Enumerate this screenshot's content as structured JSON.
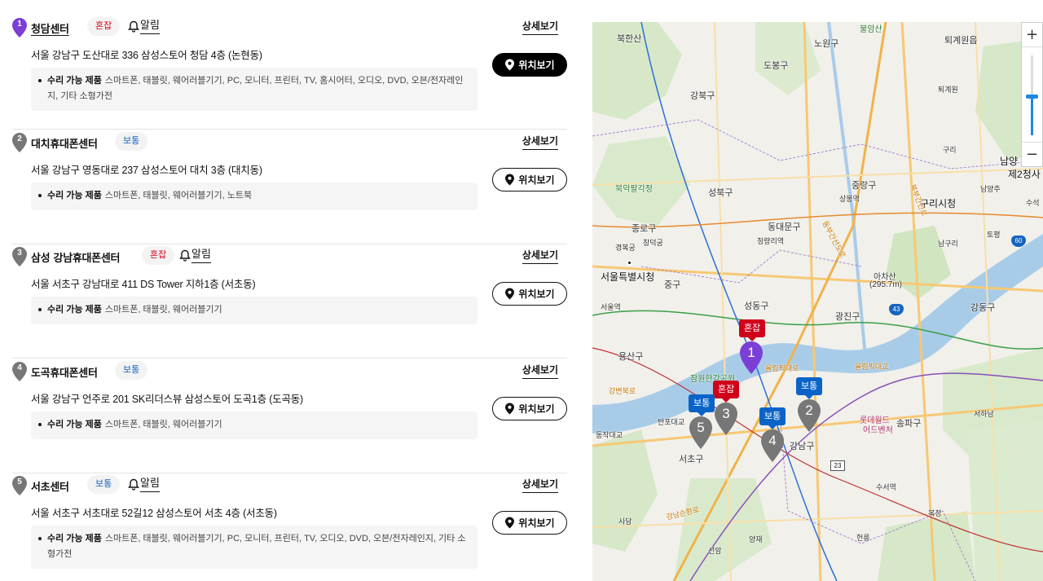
{
  "common": {
    "products_label": "수리 가능 제품",
    "detail_label": "상세보기",
    "location_label": "위치보기",
    "alarm_label": "알림"
  },
  "centers": [
    {
      "num": "1",
      "name": "청담센터",
      "status": "혼잡",
      "status_type": "busy",
      "has_alarm": true,
      "address": "서울 강남구 도산대로 336 삼성스토어 청담 4층 (논현동)",
      "products": "스마트폰, 태블릿, 웨어러블기기, PC, 모니터, 프린터, TV, 홈시어터, 오디오, DVD, 오븐/전자레인지, 기타 소형가전",
      "pin_color": "#7b3fd6",
      "selected": true
    },
    {
      "num": "2",
      "name": "대치휴대폰센터",
      "status": "보통",
      "status_type": "normal",
      "has_alarm": false,
      "address": "서울 강남구 영동대로 237 삼성스토어 대치 3층 (대치동)",
      "products": "스마트폰, 태블릿, 웨어러블기기, 노트북",
      "pin_color": "#777777",
      "selected": false
    },
    {
      "num": "3",
      "name": "삼성 강남휴대폰센터",
      "status": "혼잡",
      "status_type": "busy",
      "has_alarm": true,
      "address": "서울 서초구 강남대로 411 DS Tower 지하1층 (서초동)",
      "products": "스마트폰, 태블릿, 웨어러블기기",
      "pin_color": "#777777",
      "selected": false
    },
    {
      "num": "4",
      "name": "도곡휴대폰센터",
      "status": "보통",
      "status_type": "normal",
      "has_alarm": false,
      "address": "서울 강남구 언주로 201 SK리더스뷰 삼성스토어 도곡1층 (도곡동)",
      "products": "스마트폰, 태블릿, 웨어러블기기",
      "pin_color": "#777777",
      "selected": false
    },
    {
      "num": "5",
      "name": "서초센터",
      "status": "보통",
      "status_type": "normal",
      "has_alarm": true,
      "address": "서울 서초구 서초대로 52길12 삼성스토어 서초 4층 (서초동)",
      "products": "스마트폰, 태블릿, 웨어러블기기, PC, 모니터, 프린터, TV, 오디오, DVD, 오븐/전자레인지, 기타 소형가전",
      "pin_color": "#777777",
      "selected": false
    }
  ],
  "map": {
    "zoom_in": "+",
    "zoom_out": "−",
    "labels": {
      "l01": "북한산",
      "l02": "노원구",
      "l03": "퇴계원읍",
      "l04": "불암산",
      "l05": "강북구",
      "l06": "도봉구",
      "l07": "성북구",
      "l08": "중랑구",
      "l09": "상봉역",
      "l10": "구리시청",
      "l11": "남양",
      "l12": "제2청사",
      "l13": "북악팔각정",
      "l14": "종로구",
      "l15": "동대문구",
      "l16": "청량리역",
      "l17": "경복궁",
      "l18": "창덕궁",
      "l19": "서울특별시청",
      "l20": "중구",
      "l21": "아차산",
      "l22": "(295.7m)",
      "l23": "광진구",
      "l24": "강동구",
      "l25": "성동구",
      "l26": "서울역",
      "l27": "용산구",
      "l28": "잠원한강공원",
      "l29": "강변북로",
      "l30": "올림픽대교",
      "l31": "반포대교",
      "l32": "동작대교",
      "l33": "서초구",
      "l34": "강남구",
      "l35": "롯데월드",
      "l36": "어드벤처",
      "l37": "송파구",
      "l38": "서하남",
      "l39": "수서역",
      "l40": "사당",
      "l41": "양재",
      "l42": "선암",
      "l43": "헌릉",
      "l44": "복정",
      "l45": "구리",
      "l46": "퇴계원",
      "l47": "토평",
      "l48": "남구리",
      "l49": "수석",
      "l50": "남양주",
      "l51": "올림픽대로",
      "l52": "동부간선도로",
      "l53": "강남순환로",
      "l54": "북부간선로"
    },
    "shields": {
      "s43": "43",
      "s60": "60",
      "s23": "23"
    },
    "markers": [
      {
        "num": "1",
        "tag": "혼잡",
        "tag_type": "busy",
        "color": "#7b3fd6"
      },
      {
        "num": "2",
        "tag": "보통",
        "tag_type": "normal",
        "color": "#777777"
      },
      {
        "num": "3",
        "tag": "혼잡",
        "tag_type": "busy",
        "color": "#777777"
      },
      {
        "num": "4",
        "tag": "보통",
        "tag_type": "normal",
        "color": "#777777"
      },
      {
        "num": "5",
        "tag": "보통",
        "tag_type": "normal",
        "color": "#777777"
      }
    ]
  }
}
